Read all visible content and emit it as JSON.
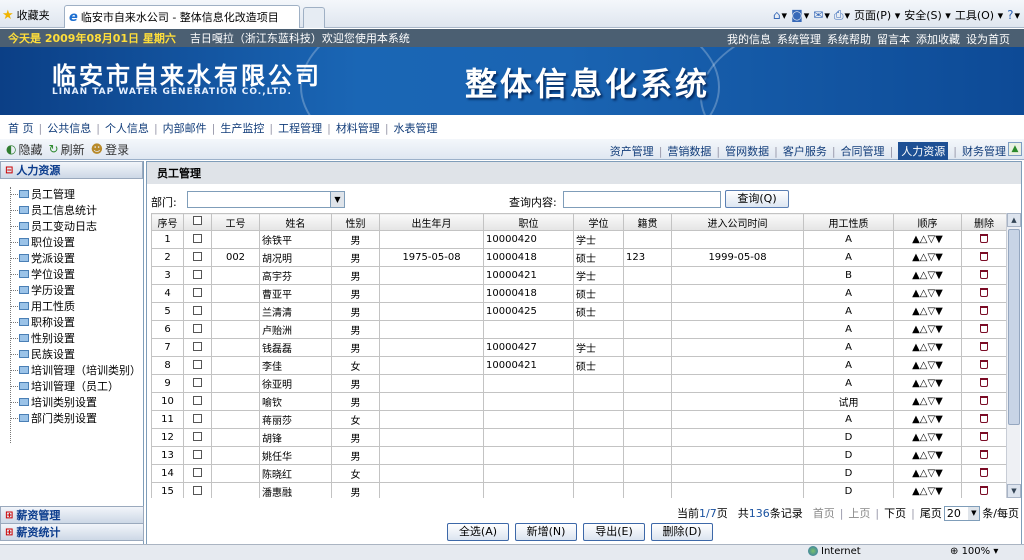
{
  "browser": {
    "favorites": "收藏夹",
    "tab_title": "临安市自来水公司 - 整体信息化改造项目",
    "commands": [
      {
        "icon": "home-icon",
        "glyph": "⌂",
        "label": "▾"
      },
      {
        "icon": "feeds-icon",
        "glyph": "◙",
        "label": "▾"
      },
      {
        "icon": "mail-icon",
        "glyph": "✉",
        "label": "▾"
      },
      {
        "icon": "print-icon",
        "glyph": "⎙",
        "label": "▾"
      },
      {
        "icon": "page-icon",
        "glyph": "",
        "label": "页面(P) ▾"
      },
      {
        "icon": "safety-icon",
        "glyph": "",
        "label": "安全(S) ▾"
      },
      {
        "icon": "tools-icon",
        "glyph": "",
        "label": "工具(O) ▾"
      },
      {
        "icon": "help-icon",
        "glyph": "?",
        "label": "▾"
      }
    ]
  },
  "topstrip": {
    "date": "今天是  2009年08月01日  星期六",
    "welcome": "吉日嘎拉（浙江东蓝科技）欢迎您使用本系统",
    "links": [
      "我的信息",
      "系统管理",
      "系统帮助",
      "留言本",
      "添加收藏",
      "设为首页"
    ]
  },
  "banner": {
    "company_cn": "临安市自来水有限公司",
    "company_en": "LINAN TAP WATER GENERATION CO.,LTD.",
    "system_title": "整体信息化系统"
  },
  "mainnav": [
    "首 页",
    "公共信息",
    "个人信息",
    "内部邮件",
    "生产监控",
    "工程管理",
    "材料管理",
    "水表管理"
  ],
  "toolbar": {
    "hide": "隐藏",
    "refresh": "刷新",
    "login": "登录"
  },
  "subnav": [
    "资产管理",
    "营销数据",
    "管网数据",
    "客户服务",
    "合同管理",
    "人力资源",
    "财务管理"
  ],
  "subnav_active": 5,
  "sidebar": {
    "title": "人力资源",
    "items": [
      "员工管理",
      "员工信息统计",
      "员工变动日志",
      "职位设置",
      "党派设置",
      "学位设置",
      "学历设置",
      "用工性质",
      "职称设置",
      "性别设置",
      "民族设置",
      "培训管理（培训类别）",
      "培训管理（员工）",
      "培训类别设置",
      "部门类别设置"
    ],
    "bottom": [
      "薪资管理",
      "薪资统计"
    ]
  },
  "content": {
    "title": "员工管理",
    "dept_label": "部门:",
    "query_label": "查询内容:",
    "query_button": "查询(Q)",
    "columns": [
      "序号",
      "",
      "工号",
      "姓名",
      "性别",
      "出生年月",
      "职位",
      "学位",
      "籍贯",
      "进入公司时间",
      "用工性质",
      "顺序",
      "删除"
    ],
    "order_arrows": "▲△▽▼",
    "rows": [
      {
        "no": "1",
        "id": "",
        "name": "徐铁平",
        "sex": "男",
        "birth": "",
        "position": "10000420",
        "degree": "学士",
        "origin": "",
        "join": "",
        "type": "A"
      },
      {
        "no": "2",
        "id": "002",
        "name": "胡况明",
        "sex": "男",
        "birth": "1975-05-08",
        "position": "10000418",
        "degree": "硕士",
        "origin": "123",
        "join": "1999-05-08",
        "type": "A"
      },
      {
        "no": "3",
        "id": "",
        "name": "高宇芬",
        "sex": "男",
        "birth": "",
        "position": "10000421",
        "degree": "学士",
        "origin": "",
        "join": "",
        "type": "B"
      },
      {
        "no": "4",
        "id": "",
        "name": "曹亚平",
        "sex": "男",
        "birth": "",
        "position": "10000418",
        "degree": "硕士",
        "origin": "",
        "join": "",
        "type": "A"
      },
      {
        "no": "5",
        "id": "",
        "name": "兰清清",
        "sex": "男",
        "birth": "",
        "position": "10000425",
        "degree": "硕士",
        "origin": "",
        "join": "",
        "type": "A"
      },
      {
        "no": "6",
        "id": "",
        "name": "卢贻洲",
        "sex": "男",
        "birth": "",
        "position": "",
        "degree": "",
        "origin": "",
        "join": "",
        "type": "A"
      },
      {
        "no": "7",
        "id": "",
        "name": "钱磊磊",
        "sex": "男",
        "birth": "",
        "position": "10000427",
        "degree": "学士",
        "origin": "",
        "join": "",
        "type": "A"
      },
      {
        "no": "8",
        "id": "",
        "name": "李佳",
        "sex": "女",
        "birth": "",
        "position": "10000421",
        "degree": "硕士",
        "origin": "",
        "join": "",
        "type": "A"
      },
      {
        "no": "9",
        "id": "",
        "name": "徐亚明",
        "sex": "男",
        "birth": "",
        "position": "",
        "degree": "",
        "origin": "",
        "join": "",
        "type": "A"
      },
      {
        "no": "10",
        "id": "",
        "name": "喻钦",
        "sex": "男",
        "birth": "",
        "position": "",
        "degree": "",
        "origin": "",
        "join": "",
        "type": "试用"
      },
      {
        "no": "11",
        "id": "",
        "name": "蒋丽莎",
        "sex": "女",
        "birth": "",
        "position": "",
        "degree": "",
        "origin": "",
        "join": "",
        "type": "A"
      },
      {
        "no": "12",
        "id": "",
        "name": "胡锋",
        "sex": "男",
        "birth": "",
        "position": "",
        "degree": "",
        "origin": "",
        "join": "",
        "type": "D"
      },
      {
        "no": "13",
        "id": "",
        "name": "姚任华",
        "sex": "男",
        "birth": "",
        "position": "",
        "degree": "",
        "origin": "",
        "join": "",
        "type": "D"
      },
      {
        "no": "14",
        "id": "",
        "name": "陈晓红",
        "sex": "女",
        "birth": "",
        "position": "",
        "degree": "",
        "origin": "",
        "join": "",
        "type": "D"
      },
      {
        "no": "15",
        "id": "",
        "name": "潘惠融",
        "sex": "男",
        "birth": "",
        "position": "",
        "degree": "",
        "origin": "",
        "join": "",
        "type": "D"
      }
    ],
    "pager": {
      "current_prefix": "当前",
      "current": "1/7",
      "current_suffix": "页",
      "total_prefix": "共",
      "total": "136",
      "total_suffix": "条记录",
      "first": "首页",
      "prev": "上页",
      "next": "下页",
      "last": "尾页",
      "page_size": "20",
      "per_page": "条/每页"
    },
    "actions": [
      "全选(A)",
      "新增(N)",
      "导出(E)",
      "删除(D)"
    ]
  },
  "status": {
    "zone": "Internet",
    "zoom": "100%"
  },
  "colors": {
    "banner": "#1a64b2",
    "topstrip": "#4b5f72",
    "date": "#ffde3a",
    "nav_text": "#123d7a"
  }
}
